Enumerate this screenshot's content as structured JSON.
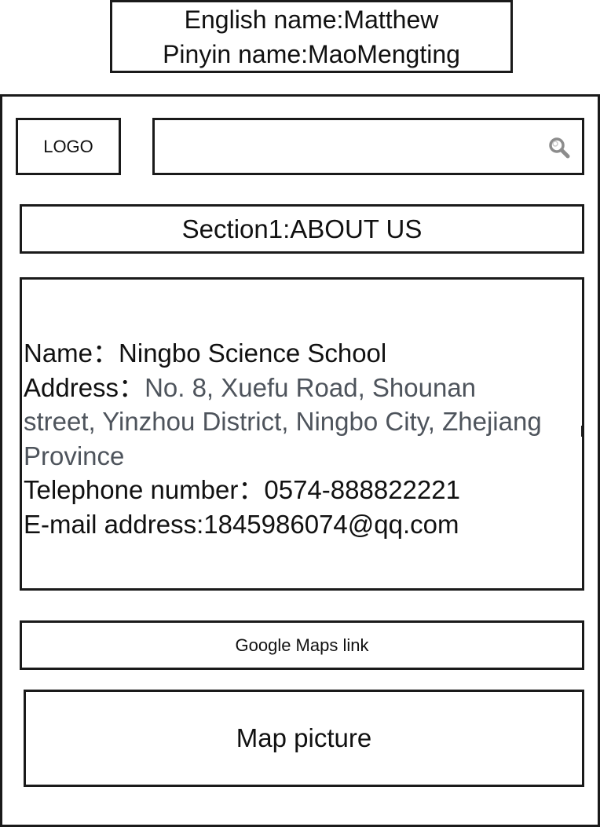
{
  "header": {
    "english_name": "English name:Matthew",
    "pinyin_name": "Pinyin name:MaoMengting"
  },
  "topbar": {
    "logo_label": "LOGO",
    "search_icon": "search-icon"
  },
  "section": {
    "title": "Section1:ABOUT US"
  },
  "contact": {
    "name_label": "Name：",
    "name_value": "Ningbo Science School",
    "address_label": "Address：",
    "address_value": "No. 8, Xuefu Road, Shounan street, Yinzhou District, Ningbo City, Zhejiang Province",
    "telephone_label": "Telephone number：",
    "telephone_value": "0574-888822221",
    "email_label": "E-mail address:",
    "email_value": "1845986074@qq.com"
  },
  "maps": {
    "link_label": "Google Maps link",
    "picture_label": "Map picture"
  },
  "colors": {
    "border": "#1a1a1a",
    "text": "#111111",
    "address_value": "#4e545c",
    "icon": "#8c8c8c"
  }
}
